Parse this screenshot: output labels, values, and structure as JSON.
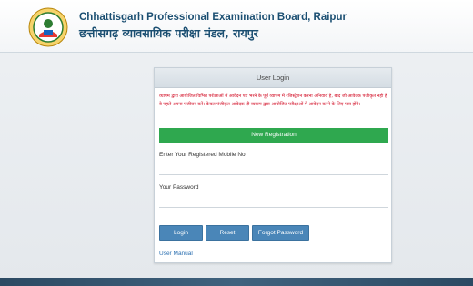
{
  "header": {
    "title_en": "Chhattisgarh Professional Examination Board, Raipur",
    "title_hi": "छत्तीसगढ़ व्यावसायिक परीक्षा मंडल, रायपुर"
  },
  "login": {
    "title": "User Login",
    "notice": "व्यापम द्वारा आयोजित विभिन्न परीक्षाओं में आवेदन पत्र भरने के पूर्व व्यापम में रजिस्ट्रेशन करना अनिवार्य है, बाद जो आवेदक पंजीकृत नहीं है वे पहले अपना पंजीयन करें। केवल पंजीकृत आवेदक ही व्यापम द्वारा आयोजित परीक्षाओं में आवेदन करने के लिए पात्र होंगे।",
    "new_registration": "New Registration",
    "mobile_label": "Enter Your Registered Mobile No",
    "password_label": "Your Password",
    "login_button": "Login",
    "reset_button": "Reset",
    "forgot_button": "Forgot Password",
    "user_manual": "User Manual"
  },
  "colors": {
    "brand": "#1b4f72",
    "notice": "#d0021b",
    "register": "#2fa84f",
    "button": "#4a86b8"
  }
}
